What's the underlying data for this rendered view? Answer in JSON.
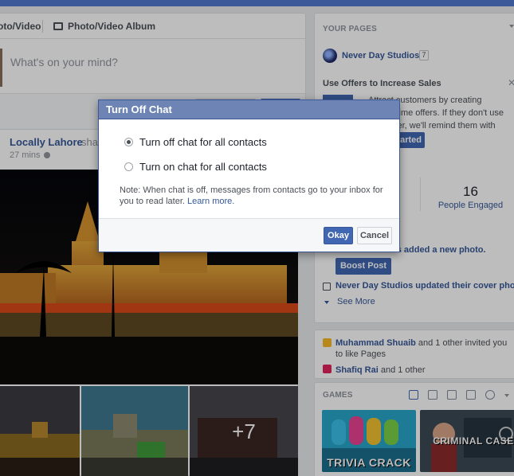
{
  "composer": {
    "tab_photo_video": "oto/Video",
    "tab_album": "Photo/Video Album",
    "placeholder": "What's on your mind?"
  },
  "post": {
    "author": "Locally Lahore",
    "action_fragment": "shar",
    "time": "27 mins",
    "more_photos": "+7"
  },
  "your_pages": {
    "heading": "YOUR PAGES",
    "page_name": "Never Day Studios",
    "page_badge": "7",
    "offer_title": "Use Offers to Increase Sales",
    "offer_text": "Attract customers by creating limited-time offers. If they don't use your offer, we'll remind them with notifications.",
    "get_started": "tarted",
    "stat_number": "16",
    "stat_label": "People Engaged",
    "activity_photo": "os added a new photo.",
    "boost_post": "Boost Post",
    "activity_cover": "Never Day Studios updated their cover photo.",
    "see_more": "See More"
  },
  "invites": {
    "line1_name": "Muhammad Shuaib",
    "line1_rest": " and 1 other invited you to like Pages",
    "line2_name": "Shafiq Rai",
    "line2_rest": " and 1 other"
  },
  "games": {
    "heading": "GAMES",
    "game1": "TRIVIA CRACK",
    "game2": "CRIMINAL CASE"
  },
  "dialog": {
    "title": "Turn Off Chat",
    "option_off": "Turn off chat for all contacts",
    "option_on": "Turn on chat for all contacts",
    "selected": "off",
    "note": "Note: When chat is off, messages from contacts go to your inbox for you to read later.",
    "learn_more": "Learn more.",
    "okay": "Okay",
    "cancel": "Cancel"
  },
  "colors": {
    "brand": "#3b5998",
    "dialog_title_bg": "#6d84b4",
    "button_primary": "#4267b2"
  }
}
